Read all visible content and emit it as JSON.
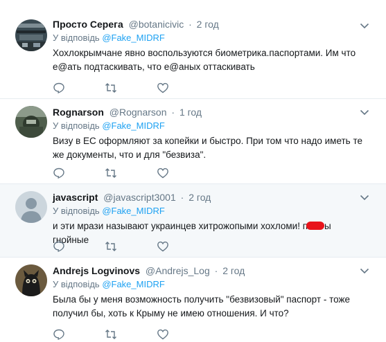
{
  "reply_prefix": "У відповідь",
  "tweets": [
    {
      "name": "Просто Серега",
      "handle": "@botanicivic",
      "dot": "·",
      "time": "2 год",
      "reply_handle": "@Fake_MIDRF",
      "text": "Хохлокрымчане явно воспользуются биометрика.паспортами. Им что е@ать подтаскивать, что е@аных оттаскивать"
    },
    {
      "name": "Rognarson",
      "handle": "@Rognarson",
      "dot": "·",
      "time": "1 год",
      "reply_handle": "@Fake_MIDRF",
      "text": "Визу в ЕС оформляют за копейки и быстро. При том что надо иметь те же документы, что и для \"безвиза\"."
    },
    {
      "name": "javascript",
      "handle": "@javascript3001",
      "dot": "·",
      "time": "2 год",
      "reply_handle": "@Fake_MIDRF",
      "text_before": "и эти мрази называют украинцев хитрожопыми хохломи! п",
      "text_after": "ы гнойные"
    },
    {
      "name": "Andrejs Logvinovs",
      "handle": "@Andrejs_Log",
      "dot": "·",
      "time": "2 год",
      "reply_handle": "@Fake_MIDRF",
      "text": "Была бы у меня возможность получить \"безвизовый\" паспорт - тоже получил бы, хоть к Крыму не имею отношения. И что?"
    }
  ],
  "colors": {
    "link": "#1da1f2",
    "secondary": "#657786",
    "highlight_bg": "#f5f8fa",
    "redaction": "#e8141b"
  },
  "icons": [
    "reply-icon",
    "retweet-icon",
    "like-icon",
    "caret-down-icon"
  ]
}
